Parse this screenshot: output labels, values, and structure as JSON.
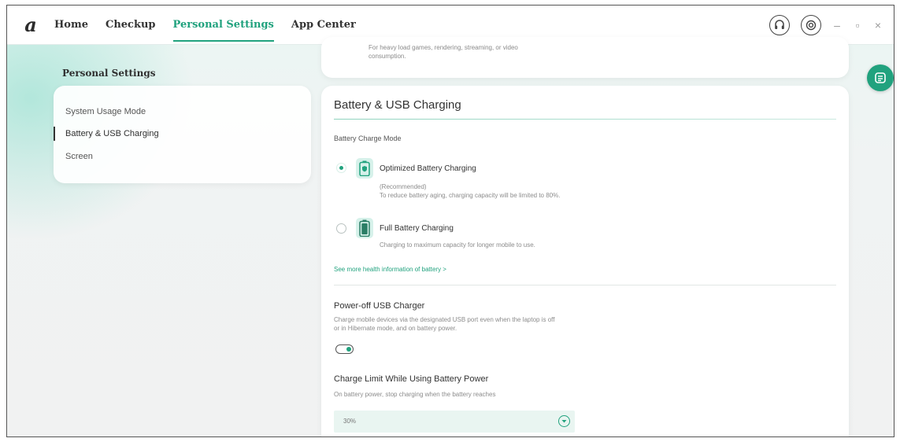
{
  "app": {
    "logo_text": "a",
    "nav": [
      {
        "label": "Home"
      },
      {
        "label": "Checkup"
      },
      {
        "label": "Personal Settings"
      },
      {
        "label": "App Center"
      }
    ],
    "active_nav_index": 2,
    "accent_color": "#21a27e"
  },
  "window_controls": {
    "minimize": "–",
    "restore": "▫",
    "close": "×"
  },
  "sidebar": {
    "title": "Personal Settings",
    "items": [
      {
        "label": "System Usage Mode"
      },
      {
        "label": "Battery & USB Charging"
      },
      {
        "label": "Screen"
      }
    ],
    "active_index": 1
  },
  "top_card": {
    "text_line1": "For heavy load games, rendering, streaming, or video",
    "text_line2": "consumption."
  },
  "battery": {
    "title": "Battery & USB Charging",
    "charge_mode_label": "Battery Charge Mode",
    "options": [
      {
        "title": "Optimized Battery Charging",
        "desc_line1": "(Recommended)",
        "desc_line2": "To reduce battery aging, charging capacity will be limited to 80%.",
        "selected": true
      },
      {
        "title": "Full Battery Charging",
        "desc_line1": "Charging to maximum capacity for longer mobile to use.",
        "selected": false
      }
    ],
    "more_link": "See more health information of battery >",
    "usb_title": "Power-off USB Charger",
    "usb_desc_line1": "Charge mobile devices via the designated USB port even when the laptop is off",
    "usb_desc_line2": "or in Hibernate mode, and on battery power.",
    "usb_enabled": true,
    "limit_title": "Charge Limit While Using Battery Power",
    "limit_desc": "On battery power, stop charging when the battery reaches",
    "limit_value": "30%"
  }
}
